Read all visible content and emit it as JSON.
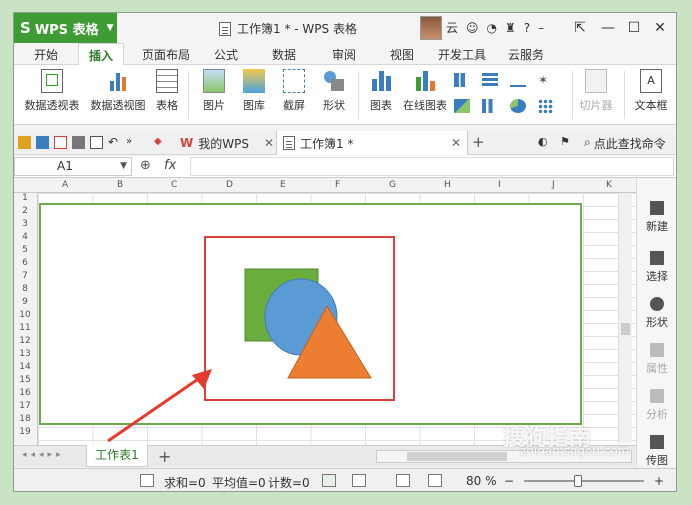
{
  "app": {
    "name": "WPS 表格",
    "logo": "S"
  },
  "window": {
    "doc_title": "工作簿1 * - WPS 表格",
    "user_text": "云"
  },
  "tabs": [
    "开始",
    "插入",
    "页面布局",
    "公式",
    "数据",
    "审阅",
    "视图",
    "开发工具",
    "云服务"
  ],
  "active_tab": "插入",
  "ribbon": {
    "pivot_table": "数据透视表",
    "pivot_chart": "数据透视图",
    "table": "表格",
    "picture": "图片",
    "gallery": "图库",
    "screenshot": "截屏",
    "shape": "形状",
    "chart": "图表",
    "online_chart": "在线图表",
    "clip": "切片器",
    "textbox": "文本框"
  },
  "doc_tabs": {
    "my_wps": "我的WPS",
    "workbook": "工作簿1 *"
  },
  "search": "点此查找命令",
  "formula": {
    "cell": "A1",
    "fx": "fx"
  },
  "columns": [
    "A",
    "B",
    "C",
    "D",
    "E",
    "F",
    "G",
    "H",
    "I",
    "J",
    "K"
  ],
  "rows": [
    "1",
    "2",
    "3",
    "4",
    "5",
    "6",
    "7",
    "8",
    "9",
    "10",
    "11",
    "12",
    "13",
    "14",
    "15",
    "16",
    "17",
    "18",
    "19"
  ],
  "right_panel": [
    "新建",
    "选择",
    "形状",
    "属性",
    "分析",
    "传图"
  ],
  "sheet": {
    "name": "工作表1",
    "add": "+"
  },
  "status": {
    "sum": "求和=0",
    "avg": "平均值=0",
    "count": "计数=0",
    "zoom": "80 %"
  },
  "watermark": {
    "brand": "搜狗指南",
    "url": "zhinan.sogou.com"
  },
  "colors": {
    "green": "#3f9c35",
    "rect": "#6aad3d",
    "circle": "#5b9bd5",
    "triangle": "#ed7d31",
    "red": "#d9413a"
  }
}
